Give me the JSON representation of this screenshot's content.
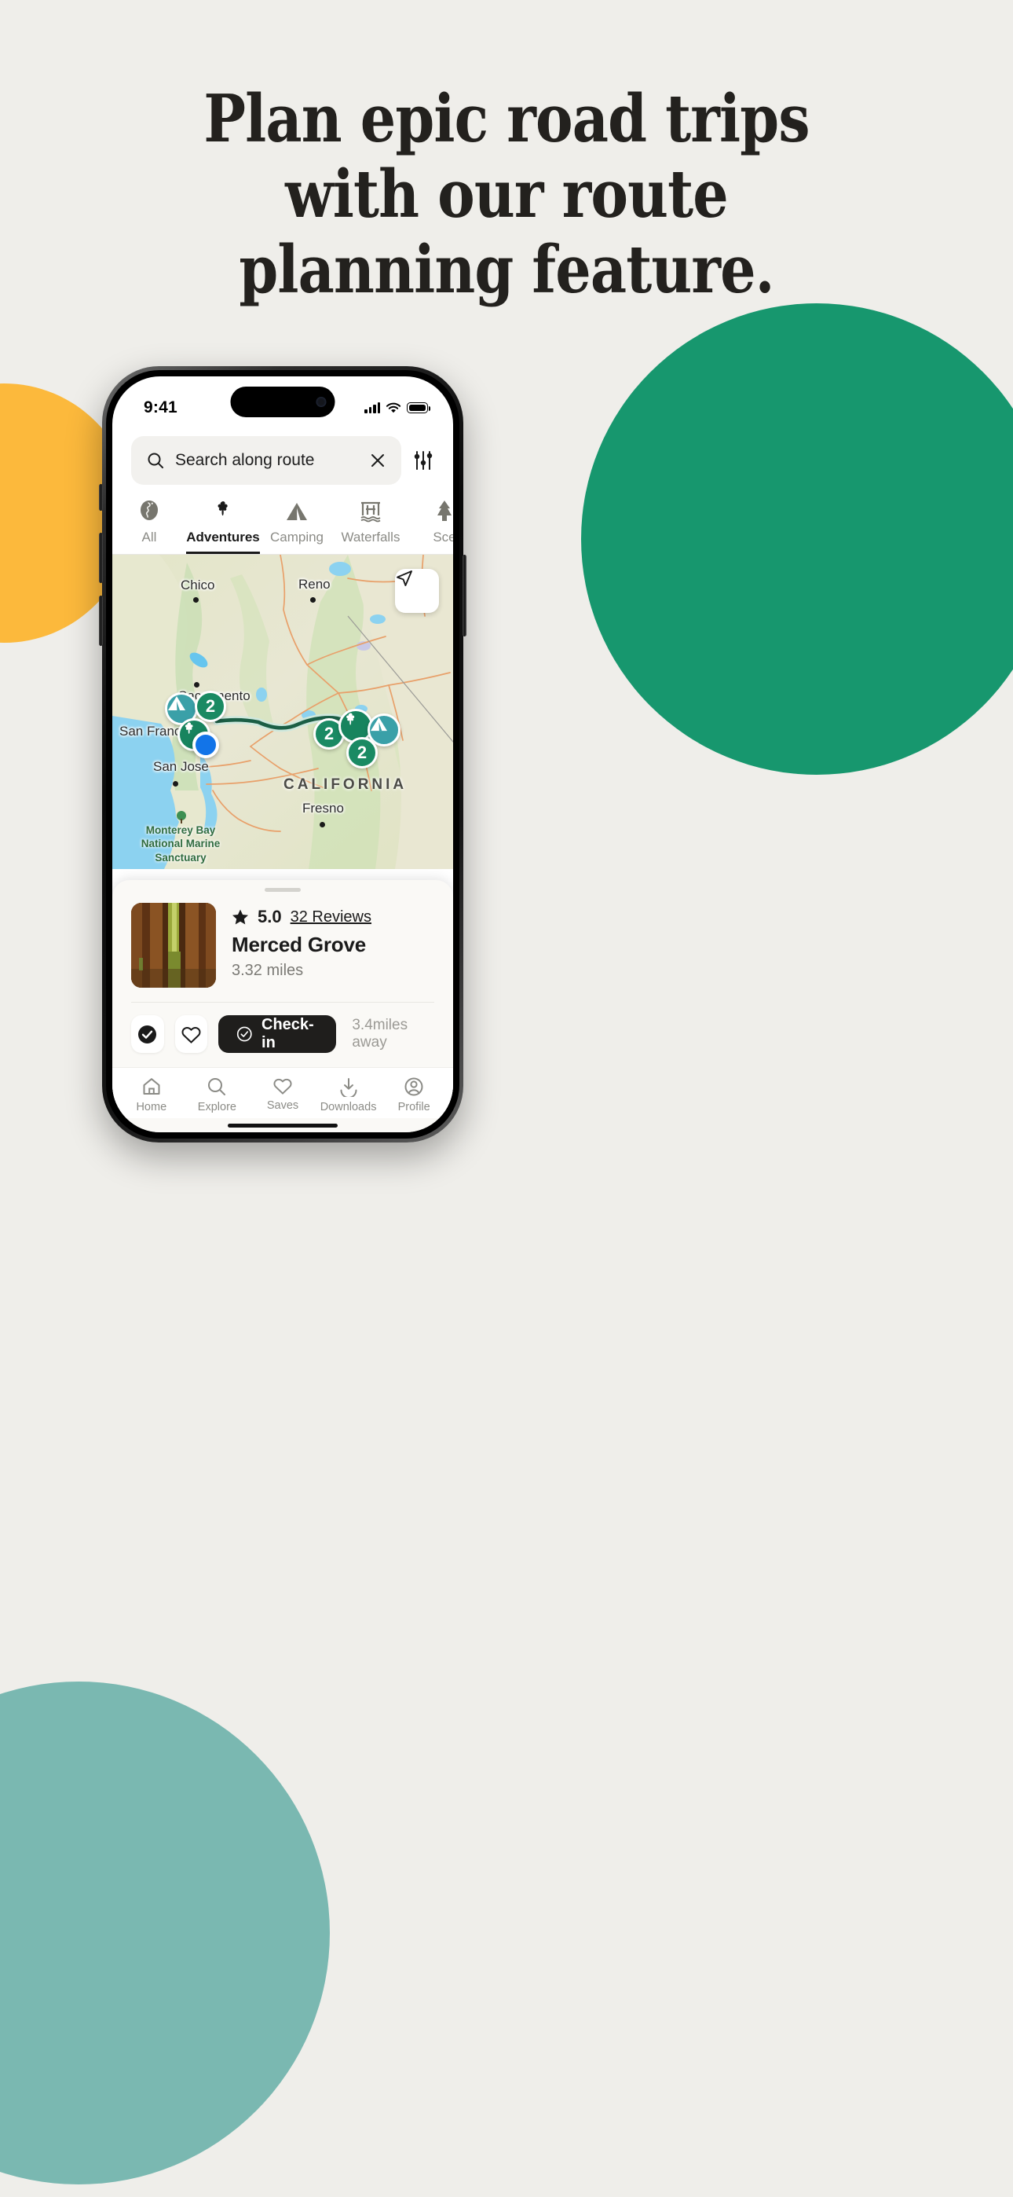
{
  "page": {
    "background_color": "#efeeea",
    "headline_lines": [
      "Plan epic road trips",
      "with our route",
      "planning feature."
    ],
    "blobs": [
      {
        "name": "green-circle",
        "color": "#17976e"
      },
      {
        "name": "yellow-circle",
        "color": "#fcb93c"
      },
      {
        "name": "teal-circle",
        "color": "#7ab8b1"
      }
    ]
  },
  "status_bar": {
    "time": "9:41",
    "signal_icon": "cellular-bars-icon",
    "wifi_icon": "wifi-icon",
    "battery_icon": "battery-icon"
  },
  "search": {
    "icon": "search-icon",
    "value": "Search along route",
    "placeholder": "Search along route",
    "clear_icon": "close-icon",
    "filter_icon": "filter-sliders-icon"
  },
  "tabs": {
    "active": "Adventures",
    "items": [
      {
        "label": "All",
        "icon": "globe-icon",
        "active": false
      },
      {
        "label": "Adventures",
        "icon": "tree-icon",
        "active": true
      },
      {
        "label": "Camping",
        "icon": "tent-icon",
        "active": false
      },
      {
        "label": "Waterfalls",
        "icon": "waterfall-icon",
        "active": false
      },
      {
        "label": "Sce",
        "icon": "pine-tree-icon",
        "active": false
      }
    ]
  },
  "map": {
    "locate_icon": "navigate-arrow-icon",
    "route_color": "#1b5e45",
    "route_casing_color": "#cfe8dd",
    "city_labels": [
      "Chico",
      "Reno",
      "Sacramento",
      "San Francisco",
      "San Jose",
      "Fresno"
    ],
    "region_label": "CALIFORNIA",
    "park_label": "Monterey Bay\nNational Marine\nSanctuary",
    "markers": [
      {
        "name": "tent-marker",
        "icon": "tent-icon",
        "color": "#3aa0a8"
      },
      {
        "name": "count-badge",
        "label": "2",
        "color": "#1a8a63"
      },
      {
        "name": "tree-marker",
        "icon": "tree-icon",
        "color": "#17845e"
      },
      {
        "name": "user-location",
        "icon": "location-dot-icon",
        "color": "#1274e8"
      },
      {
        "name": "count-badge-2",
        "label": "2",
        "color": "#1a8a63"
      },
      {
        "name": "tree-marker-2",
        "icon": "tree-icon",
        "color": "#17845e"
      },
      {
        "name": "tent-marker-2",
        "icon": "tent-icon",
        "color": "#3aa0a8"
      },
      {
        "name": "count-badge-3",
        "label": "2",
        "color": "#1a8a63"
      }
    ]
  },
  "poi_card": {
    "star_icon": "star-icon",
    "rating": "5.0",
    "reviews_link": "32 Reviews",
    "name": "Merced Grove",
    "distance": "3.32 miles",
    "thumbnail_alt": "redwood-trees-photo"
  },
  "actions": {
    "check_icon": "check-circle-filled-icon",
    "favorite_icon": "heart-outline-icon",
    "checkin_icon": "check-circle-outline-icon",
    "checkin_label": "Check-in",
    "away_text": "3.4miles away"
  },
  "tabbar": {
    "items": [
      {
        "label": "Home",
        "icon": "home-icon"
      },
      {
        "label": "Explore",
        "icon": "search-icon"
      },
      {
        "label": "Saves",
        "icon": "heart-icon"
      },
      {
        "label": "Downloads",
        "icon": "download-icon"
      },
      {
        "label": "Profile",
        "icon": "person-circle-icon"
      }
    ]
  }
}
